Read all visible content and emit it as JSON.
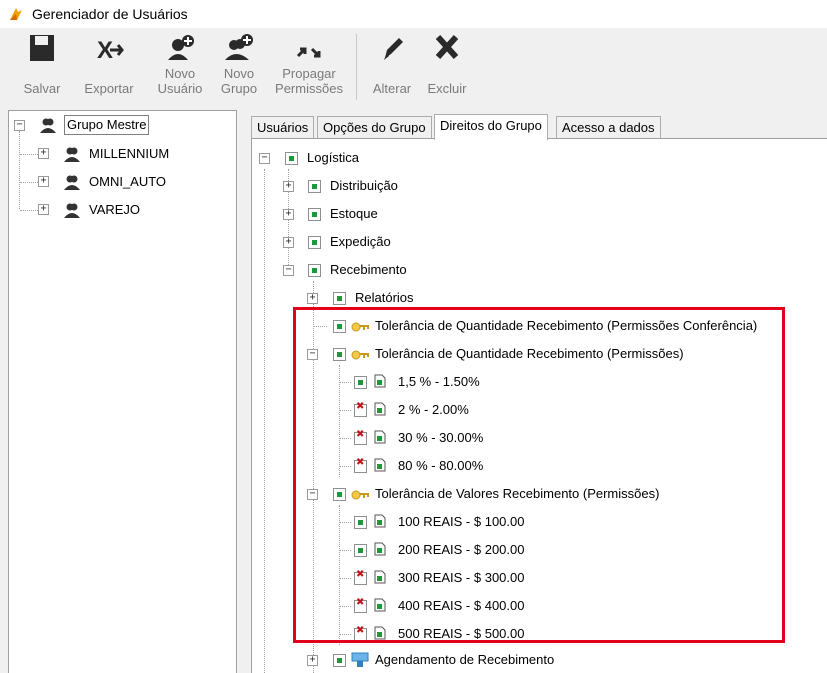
{
  "window": {
    "title": "Gerenciador de Usuários",
    "accent": "#e8a000"
  },
  "toolbar": {
    "buttons": [
      {
        "id": "salvar",
        "line1": "",
        "line2": "Salvar",
        "icon": "save-icon"
      },
      {
        "id": "exportar",
        "line1": "",
        "line2": "Exportar",
        "icon": "export-icon"
      },
      {
        "id": "novo_usuario",
        "line1": "Novo",
        "line2": "Usuário",
        "icon": "add-user-icon"
      },
      {
        "id": "novo_grupo",
        "line1": "Novo",
        "line2": "Grupo",
        "icon": "add-group-icon"
      },
      {
        "id": "propagar",
        "line1": "Propagar",
        "line2": "Permissões",
        "icon": "propagate-icon"
      },
      {
        "id": "alterar",
        "line1": "",
        "line2": "Alterar",
        "icon": "pencil-icon"
      },
      {
        "id": "excluir",
        "line1": "",
        "line2": "Excluir",
        "icon": "close-icon"
      }
    ]
  },
  "groups": {
    "root": "Grupo Mestre",
    "items": [
      "MILLENNIUM",
      "OMNI_AUTO",
      "VAREJO"
    ]
  },
  "tabs": [
    {
      "label": "Usuários",
      "active": false
    },
    {
      "label": "Opções do Grupo",
      "active": false
    },
    {
      "label": "Direitos do Grupo",
      "active": true
    },
    {
      "label": "Acesso a dados",
      "active": false
    }
  ],
  "tree": {
    "logistica": "Logística",
    "distribuicao": "Distribuição",
    "estoque": "Estoque",
    "expedicao": "Expedição",
    "recebimento": "Recebimento",
    "relatorios": "Relatórios",
    "tol_conf": "Tolerância de Quantidade Recebimento (Permissões Conferência)",
    "tol_qtd": "Tolerância de Quantidade Recebimento (Permissões)",
    "qtd_items": [
      {
        "label": "1,5 % - 1.50%",
        "checked": true
      },
      {
        "label": "2 % - 2.00%",
        "checked": false
      },
      {
        "label": "30 % - 30.00%",
        "checked": false
      },
      {
        "label": "80 % - 80.00%",
        "checked": false
      }
    ],
    "tol_val": "Tolerância de Valores Recebimento (Permissões)",
    "val_items": [
      {
        "label": "100 REAIS - $ 100.00",
        "checked": true
      },
      {
        "label": "200 REAIS - $ 200.00",
        "checked": true
      },
      {
        "label": "300 REAIS - $ 300.00",
        "checked": false
      },
      {
        "label": "400 REAIS - $ 400.00",
        "checked": false
      },
      {
        "label": "500 REAIS - $ 500.00",
        "checked": false
      }
    ],
    "agendamento": "Agendamento de Recebimento"
  },
  "highlight_color": "#e3001b"
}
